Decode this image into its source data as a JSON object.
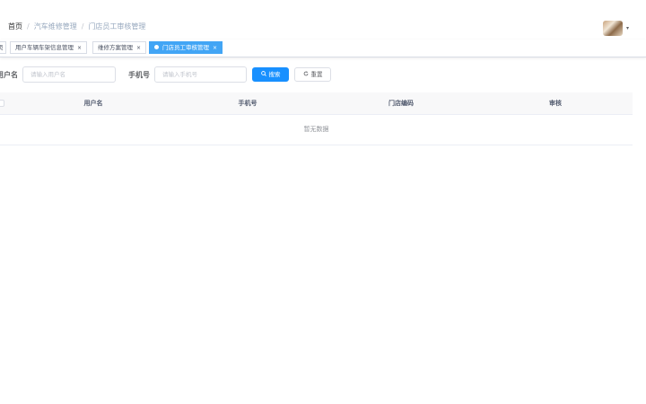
{
  "breadcrumb": {
    "items": [
      "首页",
      "汽车维修管理",
      "门店员工审核管理"
    ],
    "separator": "/"
  },
  "user": {
    "avatar": "user-avatar",
    "caret": "▾"
  },
  "tags": {
    "home_partial": "页",
    "items": [
      {
        "label": "用户车辆车架信息管理",
        "close": "×"
      },
      {
        "label": "维修方案管理",
        "close": "×"
      },
      {
        "label": "门店员工审核管理",
        "close": "×",
        "active": true
      }
    ],
    "active_color": "#42a5f5"
  },
  "search_form": {
    "username_label": "用户名",
    "username_placeholder": "请输入用户名",
    "phone_label": "手机号",
    "phone_placeholder": "请输入手机号",
    "search_button": "搜索",
    "reset_button": "重置",
    "search_icon": "search-icon",
    "reset_icon": "refresh-icon",
    "primary_color": "#1890ff"
  },
  "table": {
    "columns": [
      "用户名",
      "手机号",
      "门店编码",
      "审核"
    ],
    "empty_text": "暂无数据"
  }
}
